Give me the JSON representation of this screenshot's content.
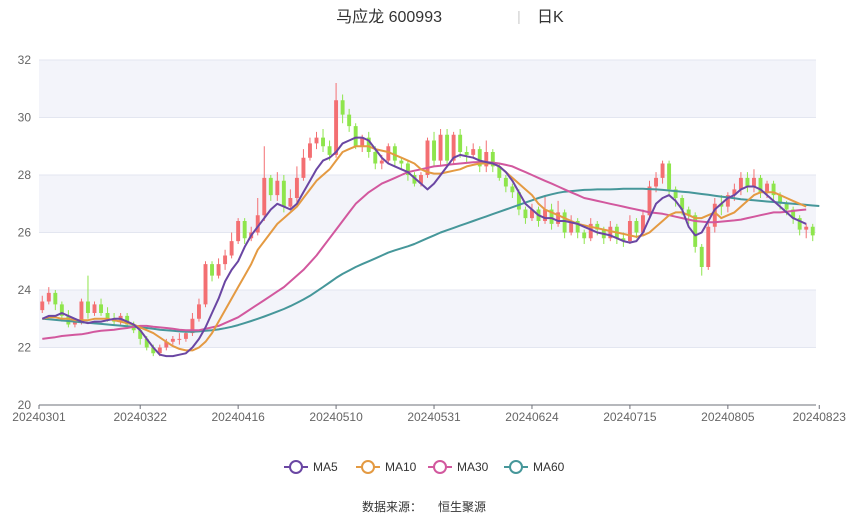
{
  "header": {
    "name": "马应龙",
    "code": "600993",
    "separator": "|",
    "period": "日K"
  },
  "footer": {
    "source_label": "数据来源：",
    "source_name": "恒生聚源"
  },
  "colors": {
    "up": "#f36f72",
    "down": "#8ee54c",
    "band": "#f3f4fa",
    "grid": "#e3e6f0",
    "ma5": "#6a46a3",
    "ma10": "#e49a42",
    "ma30": "#d2589e",
    "ma60": "#46979a"
  },
  "chart_data": {
    "type": "candlestick",
    "ylim": [
      20,
      32
    ],
    "yticks": [
      20,
      22,
      24,
      26,
      28,
      30,
      32
    ],
    "xticks": [
      {
        "index": 0,
        "label": "20240301"
      },
      {
        "index": 15,
        "label": "20240322"
      },
      {
        "index": 30,
        "label": "20240416"
      },
      {
        "index": 45,
        "label": "20240510"
      },
      {
        "index": 60,
        "label": "20240531"
      },
      {
        "index": 75,
        "label": "20240624"
      },
      {
        "index": 90,
        "label": "20240715"
      },
      {
        "index": 105,
        "label": "20240805"
      },
      {
        "index": 119,
        "label": "20240823"
      }
    ],
    "legend": [
      {
        "key": "ma5",
        "label": "MA5"
      },
      {
        "key": "ma10",
        "label": "MA10"
      },
      {
        "key": "ma30",
        "label": "MA30"
      },
      {
        "key": "ma60",
        "label": "MA60"
      }
    ],
    "candles": [
      [
        23.3,
        23.6,
        23.8,
        23.2
      ],
      [
        23.6,
        23.9,
        24.1,
        23.5
      ],
      [
        23.9,
        23.5,
        24.0,
        23.3
      ],
      [
        23.5,
        23.1,
        23.6,
        22.9
      ],
      [
        23.1,
        22.8,
        23.3,
        22.7
      ],
      [
        22.8,
        22.9,
        23.0,
        22.7
      ],
      [
        22.9,
        23.6,
        23.7,
        22.8
      ],
      [
        23.6,
        23.2,
        24.5,
        23.0
      ],
      [
        23.2,
        23.5,
        23.6,
        23.1
      ],
      [
        23.5,
        23.2,
        23.7,
        23.1
      ],
      [
        23.2,
        23.0,
        23.4,
        22.9
      ],
      [
        23.0,
        22.9,
        23.2,
        22.8
      ],
      [
        22.9,
        23.1,
        23.2,
        22.8
      ],
      [
        23.1,
        22.8,
        23.2,
        22.7
      ],
      [
        22.8,
        22.6,
        22.9,
        22.5
      ],
      [
        22.6,
        22.3,
        22.7,
        22.1
      ],
      [
        22.3,
        22.0,
        22.4,
        21.9
      ],
      [
        22.0,
        21.8,
        22.1,
        21.7
      ],
      [
        21.8,
        22.0,
        22.1,
        21.7
      ],
      [
        22.0,
        22.2,
        22.3,
        21.9
      ],
      [
        22.2,
        22.3,
        22.4,
        22.1
      ],
      [
        22.3,
        22.3,
        22.5,
        22.1
      ],
      [
        22.3,
        22.5,
        22.6,
        22.2
      ],
      [
        22.5,
        23.0,
        23.2,
        22.4
      ],
      [
        23.0,
        23.5,
        23.7,
        22.9
      ],
      [
        23.5,
        24.9,
        25.0,
        23.4
      ],
      [
        24.9,
        24.5,
        25.0,
        24.3
      ],
      [
        24.5,
        24.9,
        25.1,
        24.4
      ],
      [
        24.9,
        25.2,
        25.4,
        24.7
      ],
      [
        25.2,
        25.7,
        26.0,
        25.1
      ],
      [
        25.7,
        26.4,
        26.5,
        25.6
      ],
      [
        26.4,
        25.8,
        26.5,
        25.6
      ],
      [
        25.8,
        26.0,
        26.2,
        25.7
      ],
      [
        26.0,
        26.6,
        27.2,
        25.9
      ],
      [
        26.6,
        27.9,
        29.0,
        26.4
      ],
      [
        27.9,
        27.3,
        28.0,
        27.1
      ],
      [
        27.3,
        27.8,
        28.1,
        27.1
      ],
      [
        27.8,
        26.9,
        28.0,
        26.7
      ],
      [
        26.9,
        27.2,
        27.5,
        26.8
      ],
      [
        27.2,
        27.9,
        28.3,
        27.0
      ],
      [
        27.9,
        28.6,
        28.9,
        27.8
      ],
      [
        28.6,
        29.1,
        29.3,
        28.5
      ],
      [
        29.1,
        29.3,
        29.5,
        28.9
      ],
      [
        29.3,
        29.0,
        29.6,
        28.8
      ],
      [
        29.0,
        28.7,
        29.2,
        28.5
      ],
      [
        28.7,
        30.6,
        31.2,
        28.6
      ],
      [
        30.6,
        30.1,
        30.8,
        29.8
      ],
      [
        30.1,
        29.7,
        30.3,
        29.5
      ],
      [
        29.7,
        29.0,
        29.8,
        28.9
      ],
      [
        29.0,
        29.3,
        29.4,
        28.8
      ],
      [
        29.3,
        28.8,
        29.5,
        28.6
      ],
      [
        28.8,
        28.4,
        29.0,
        28.2
      ],
      [
        28.4,
        28.5,
        28.7,
        28.2
      ],
      [
        28.5,
        29.0,
        29.1,
        28.4
      ],
      [
        29.0,
        28.5,
        29.1,
        28.3
      ],
      [
        28.5,
        28.4,
        28.6,
        28.2
      ],
      [
        28.4,
        28.0,
        28.5,
        27.8
      ],
      [
        28.0,
        27.7,
        28.1,
        27.6
      ],
      [
        27.7,
        28.0,
        28.1,
        27.6
      ],
      [
        28.0,
        29.2,
        29.3,
        27.9
      ],
      [
        29.2,
        28.5,
        29.5,
        28.3
      ],
      [
        28.5,
        29.4,
        29.6,
        28.3
      ],
      [
        29.4,
        28.5,
        29.6,
        28.3
      ],
      [
        28.5,
        29.4,
        29.5,
        28.4
      ],
      [
        29.4,
        28.8,
        29.6,
        28.6
      ],
      [
        28.8,
        28.7,
        29.0,
        28.4
      ],
      [
        28.7,
        28.9,
        29.1,
        28.6
      ],
      [
        28.9,
        28.3,
        29.0,
        28.1
      ],
      [
        28.3,
        28.8,
        29.2,
        28.1
      ],
      [
        28.8,
        28.3,
        28.9,
        28.1
      ],
      [
        28.3,
        27.9,
        28.4,
        27.8
      ],
      [
        27.9,
        27.6,
        28.0,
        27.4
      ],
      [
        27.6,
        27.4,
        27.7,
        27.2
      ],
      [
        27.4,
        26.8,
        27.5,
        26.6
      ],
      [
        26.8,
        26.5,
        26.9,
        26.3
      ],
      [
        26.5,
        26.8,
        27.0,
        26.4
      ],
      [
        26.8,
        26.4,
        26.9,
        26.2
      ],
      [
        26.4,
        26.8,
        27.3,
        26.3
      ],
      [
        26.8,
        26.3,
        27.0,
        26.1
      ],
      [
        26.3,
        26.7,
        27.1,
        26.2
      ],
      [
        26.7,
        26.0,
        26.8,
        25.8
      ],
      [
        26.0,
        26.4,
        26.6,
        25.9
      ],
      [
        26.4,
        26.0,
        26.5,
        25.8
      ],
      [
        26.0,
        25.8,
        26.1,
        25.6
      ],
      [
        25.8,
        26.3,
        26.5,
        25.7
      ],
      [
        26.3,
        26.1,
        26.4,
        25.9
      ],
      [
        26.1,
        25.8,
        26.2,
        25.6
      ],
      [
        25.8,
        26.2,
        26.4,
        25.7
      ],
      [
        26.2,
        25.8,
        26.3,
        25.6
      ],
      [
        25.8,
        25.7,
        26.0,
        25.5
      ],
      [
        25.7,
        26.4,
        26.6,
        25.6
      ],
      [
        26.4,
        26.0,
        26.5,
        25.8
      ],
      [
        26.0,
        26.6,
        26.8,
        25.9
      ],
      [
        26.6,
        27.6,
        27.8,
        26.5
      ],
      [
        27.6,
        27.9,
        28.1,
        27.4
      ],
      [
        27.9,
        28.4,
        28.5,
        27.7
      ],
      [
        28.4,
        27.5,
        28.5,
        27.3
      ],
      [
        27.5,
        27.2,
        27.6,
        26.9
      ],
      [
        27.2,
        26.8,
        27.3,
        26.6
      ],
      [
        26.8,
        26.6,
        26.9,
        26.3
      ],
      [
        26.6,
        25.5,
        26.7,
        25.3
      ],
      [
        25.5,
        24.8,
        25.6,
        24.5
      ],
      [
        24.8,
        26.2,
        26.4,
        24.7
      ],
      [
        26.2,
        27.0,
        27.2,
        26.0
      ],
      [
        27.0,
        26.9,
        27.3,
        26.6
      ],
      [
        26.9,
        27.3,
        27.4,
        26.7
      ],
      [
        27.3,
        27.5,
        27.7,
        27.1
      ],
      [
        27.5,
        27.9,
        28.1,
        27.3
      ],
      [
        27.9,
        27.6,
        28.1,
        27.4
      ],
      [
        27.6,
        27.9,
        28.2,
        27.4
      ],
      [
        27.9,
        27.4,
        28.0,
        27.2
      ],
      [
        27.4,
        27.7,
        27.8,
        27.2
      ],
      [
        27.7,
        27.3,
        27.8,
        27.1
      ],
      [
        27.3,
        27.0,
        27.4,
        26.8
      ],
      [
        27.0,
        26.8,
        27.1,
        26.6
      ],
      [
        26.8,
        26.5,
        26.9,
        26.3
      ],
      [
        26.5,
        26.1,
        26.6,
        25.9
      ],
      [
        26.1,
        26.2,
        26.3,
        25.8
      ],
      [
        26.2,
        25.9,
        26.3,
        25.7
      ]
    ],
    "ma5": [
      23.0,
      23.1,
      23.1,
      23.2,
      23.1,
      23.0,
      22.9,
      22.85,
      22.9,
      22.9,
      22.95,
      23.0,
      23.0,
      22.9,
      22.8,
      22.6,
      22.3,
      22.0,
      21.75,
      21.7,
      21.7,
      21.75,
      21.8,
      22.0,
      22.3,
      22.7,
      23.2,
      23.7,
      24.3,
      24.7,
      25.0,
      25.5,
      25.9,
      26.2,
      26.5,
      26.8,
      27.0,
      26.9,
      26.8,
      27.0,
      27.4,
      27.8,
      28.2,
      28.5,
      28.6,
      28.8,
      29.1,
      29.2,
      29.3,
      29.3,
      29.2,
      28.9,
      28.6,
      28.4,
      28.3,
      28.2,
      28.1,
      27.9,
      27.7,
      27.5,
      27.7,
      28.0,
      28.3,
      28.6,
      28.7,
      28.65,
      28.6,
      28.5,
      28.45,
      28.4,
      28.3,
      28.1,
      27.8,
      27.4,
      27.0,
      26.8,
      26.6,
      26.5,
      26.5,
      26.4,
      26.4,
      26.35,
      26.3,
      26.2,
      26.1,
      26.0,
      25.95,
      25.9,
      25.8,
      25.7,
      25.65,
      25.7,
      26.0,
      26.5,
      27.0,
      27.2,
      27.3,
      27.1,
      26.8,
      26.2,
      25.9,
      26.0,
      26.4,
      26.8,
      27.0,
      27.2,
      27.3,
      27.5,
      27.6,
      27.6,
      27.5,
      27.3,
      27.1,
      26.9,
      26.7,
      26.5,
      26.4,
      26.3
    ],
    "ma10": [
      23.0,
      23.05,
      23.05,
      23.0,
      23.0,
      22.95,
      22.95,
      22.95,
      23.0,
      23.0,
      23.0,
      22.95,
      22.9,
      22.85,
      22.8,
      22.7,
      22.6,
      22.5,
      22.35,
      22.2,
      22.05,
      21.95,
      21.9,
      21.9,
      22.0,
      22.2,
      22.5,
      22.9,
      23.3,
      23.7,
      24.1,
      24.5,
      24.9,
      25.4,
      25.7,
      26.0,
      26.3,
      26.5,
      26.7,
      26.9,
      27.2,
      27.5,
      27.8,
      28.0,
      28.2,
      28.5,
      28.8,
      28.9,
      29.0,
      29.0,
      29.0,
      28.9,
      28.85,
      28.8,
      28.7,
      28.6,
      28.5,
      28.4,
      28.2,
      28.1,
      28.05,
      28.05,
      28.1,
      28.15,
      28.2,
      28.3,
      28.35,
      28.4,
      28.4,
      28.4,
      28.3,
      28.1,
      27.9,
      27.7,
      27.5,
      27.3,
      27.0,
      26.8,
      26.7,
      26.6,
      26.5,
      26.4,
      26.3,
      26.25,
      26.2,
      26.15,
      26.1,
      26.05,
      26.0,
      25.95,
      25.9,
      25.85,
      25.9,
      26.0,
      26.2,
      26.4,
      26.6,
      26.7,
      26.7,
      26.6,
      26.5,
      26.5,
      26.6,
      26.7,
      26.5,
      26.6,
      26.7,
      26.9,
      27.1,
      27.3,
      27.4,
      27.4,
      27.4,
      27.3,
      27.2,
      27.1,
      27.0,
      26.9
    ],
    "ma30": [
      22.3,
      22.33,
      22.36,
      22.4,
      22.42,
      22.44,
      22.46,
      22.5,
      22.55,
      22.58,
      22.6,
      22.62,
      22.65,
      22.68,
      22.72,
      22.75,
      22.75,
      22.72,
      22.7,
      22.68,
      22.65,
      22.62,
      22.6,
      22.6,
      22.6,
      22.65,
      22.7,
      22.75,
      22.85,
      22.95,
      23.05,
      23.2,
      23.35,
      23.5,
      23.65,
      23.8,
      23.95,
      24.1,
      24.3,
      24.5,
      24.7,
      24.95,
      25.2,
      25.5,
      25.8,
      26.1,
      26.4,
      26.7,
      27.0,
      27.2,
      27.4,
      27.55,
      27.7,
      27.8,
      27.9,
      28.0,
      28.1,
      28.15,
      28.2,
      28.25,
      28.3,
      28.32,
      28.35,
      28.38,
      28.4,
      28.42,
      28.44,
      28.45,
      28.45,
      28.43,
      28.4,
      28.35,
      28.3,
      28.2,
      28.1,
      28.0,
      27.9,
      27.8,
      27.7,
      27.6,
      27.5,
      27.4,
      27.3,
      27.2,
      27.15,
      27.1,
      27.05,
      27.0,
      26.95,
      26.9,
      26.85,
      26.8,
      26.75,
      26.7,
      26.68,
      26.65,
      26.6,
      26.55,
      26.5,
      26.45,
      26.4,
      26.38,
      26.36,
      26.36,
      26.38,
      26.4,
      26.42,
      26.45,
      26.5,
      26.55,
      26.6,
      26.65,
      26.7,
      26.7,
      26.72,
      26.75,
      26.78,
      26.8
    ],
    "ma60": [
      23.0,
      22.98,
      22.96,
      22.94,
      22.92,
      22.9,
      22.88,
      22.86,
      22.84,
      22.82,
      22.8,
      22.78,
      22.76,
      22.74,
      22.72,
      22.7,
      22.68,
      22.65,
      22.62,
      22.6,
      22.58,
      22.56,
      22.55,
      22.55,
      22.56,
      22.58,
      22.6,
      22.63,
      22.67,
      22.72,
      22.78,
      22.85,
      22.92,
      23.0,
      23.08,
      23.16,
      23.25,
      23.34,
      23.44,
      23.55,
      23.67,
      23.8,
      23.95,
      24.1,
      24.26,
      24.42,
      24.56,
      24.68,
      24.8,
      24.9,
      25.0,
      25.1,
      25.2,
      25.3,
      25.38,
      25.45,
      25.52,
      25.6,
      25.7,
      25.8,
      25.9,
      26.0,
      26.08,
      26.16,
      26.24,
      26.32,
      26.4,
      26.48,
      26.56,
      26.64,
      26.72,
      26.8,
      26.88,
      26.96,
      27.04,
      27.12,
      27.2,
      27.27,
      27.33,
      27.38,
      27.42,
      27.44,
      27.46,
      27.48,
      27.49,
      27.5,
      27.5,
      27.5,
      27.51,
      27.52,
      27.52,
      27.52,
      27.52,
      27.51,
      27.5,
      27.48,
      27.46,
      27.44,
      27.42,
      27.4,
      27.37,
      27.34,
      27.31,
      27.28,
      27.25,
      27.22,
      27.19,
      27.16,
      27.14,
      27.12,
      27.1,
      27.08,
      27.06,
      27.04,
      27.02,
      27.0,
      26.98,
      26.96,
      26.94,
      26.92
    ]
  }
}
